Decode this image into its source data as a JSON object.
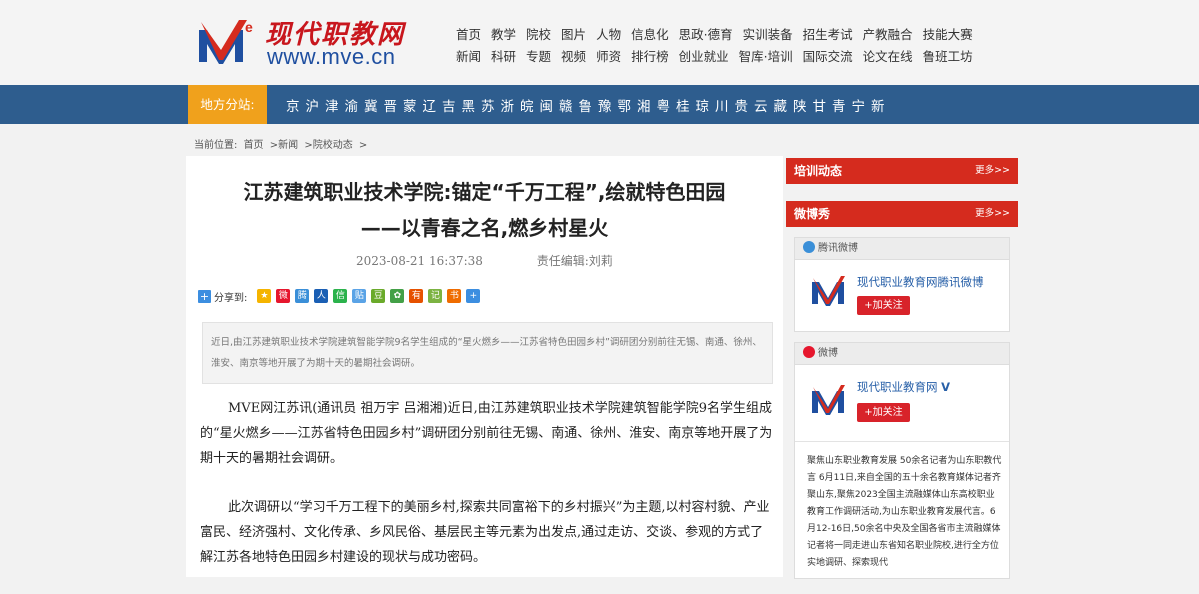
{
  "site": {
    "logo_cn": "现代职教网",
    "logo_en": "www.mve.cn"
  },
  "nav": {
    "row1": [
      "首页",
      "教学",
      "院校",
      "图片",
      "人物",
      "信息化",
      "思政·德育",
      "实训装备",
      "招生考试",
      "产教融合",
      "技能大赛"
    ],
    "row2": [
      "新闻",
      "科研",
      "专题",
      "视频",
      "师资",
      "排行榜",
      "创业就业",
      "智库·培训",
      "国际交流",
      "论文在线",
      "鲁班工坊"
    ]
  },
  "regions": {
    "label": "地方分站:",
    "items": [
      "京",
      "沪",
      "津",
      "渝",
      "冀",
      "晋",
      "蒙",
      "辽",
      "吉",
      "黑",
      "苏",
      "浙",
      "皖",
      "闽",
      "赣",
      "鲁",
      "豫",
      "鄂",
      "湘",
      "粤",
      "桂",
      "琼",
      "川",
      "贵",
      "云",
      "藏",
      "陕",
      "甘",
      "青",
      "宁",
      "新"
    ]
  },
  "breadcrumb": {
    "prefix": "当前位置:",
    "items": [
      "首页",
      ">新闻",
      ">院校动态",
      ">"
    ]
  },
  "article": {
    "title_line1": "江苏建筑职业技术学院:锚定“千万工程”,绘就特色田园",
    "title_line2": "——以青春之名,燃乡村星火",
    "date": "2023-08-21 16:37:38",
    "editor": "责任编辑:刘莉",
    "share_label": "分享到:",
    "summary": "近日,由江苏建筑职业技术学院建筑智能学院9名学生组成的“星火燃乡——江苏省特色田园乡村”调研团分别前往无锡、南通、徐州、淮安、南京等地开展了为期十天的暑期社会调研。",
    "para1": "MVE网江苏讯(通讯员 祖万宇 吕湘湘)近日,由江苏建筑职业技术学院建筑智能学院9名学生组成的“星火燃乡——江苏省特色田园乡村”调研团分别前往无锡、南通、徐州、淮安、南京等地开展了为期十天的暑期社会调研。",
    "para2": "此次调研以“学习千万工程下的美丽乡村,探索共同富裕下的乡村振兴”为主题,以村容村貌、产业富民、经济强村、文化传承、乡风民俗、基层民主等元素为出发点,通过走访、交谈、参观的方式了解江苏各地特色田园乡村建设的现状与成功密码。"
  },
  "sidebar": {
    "training_title": "培训动态",
    "training_more": "更多>>",
    "weibo_title": "微博秀",
    "weibo_more": "更多>>",
    "tencent_header": "腾讯微博",
    "tencent_name": "现代职业教育网腾讯微博",
    "tencent_follow": "+加关注",
    "sina_header": "微博",
    "sina_name": "现代职业教育网",
    "sina_follow": "+加关注",
    "post_text": "聚焦山东职业教育发展 50余名记者为山东职教代言 6月11日,来自全国的五十余名教育媒体记者齐聚山东,聚焦2023全国主流融媒体山东高校职业教育工作调研活动,为山东职业教育发展代言。6月12-16日,50余名中央及全国各省市主流融媒体记者将一同走进山东省知名职业院校,进行全方位实地调研、探索现代"
  },
  "colors": {
    "brand_red": "#d52b1e",
    "nav_blue": "#2e5d8e",
    "region_orange": "#f0a11c"
  }
}
